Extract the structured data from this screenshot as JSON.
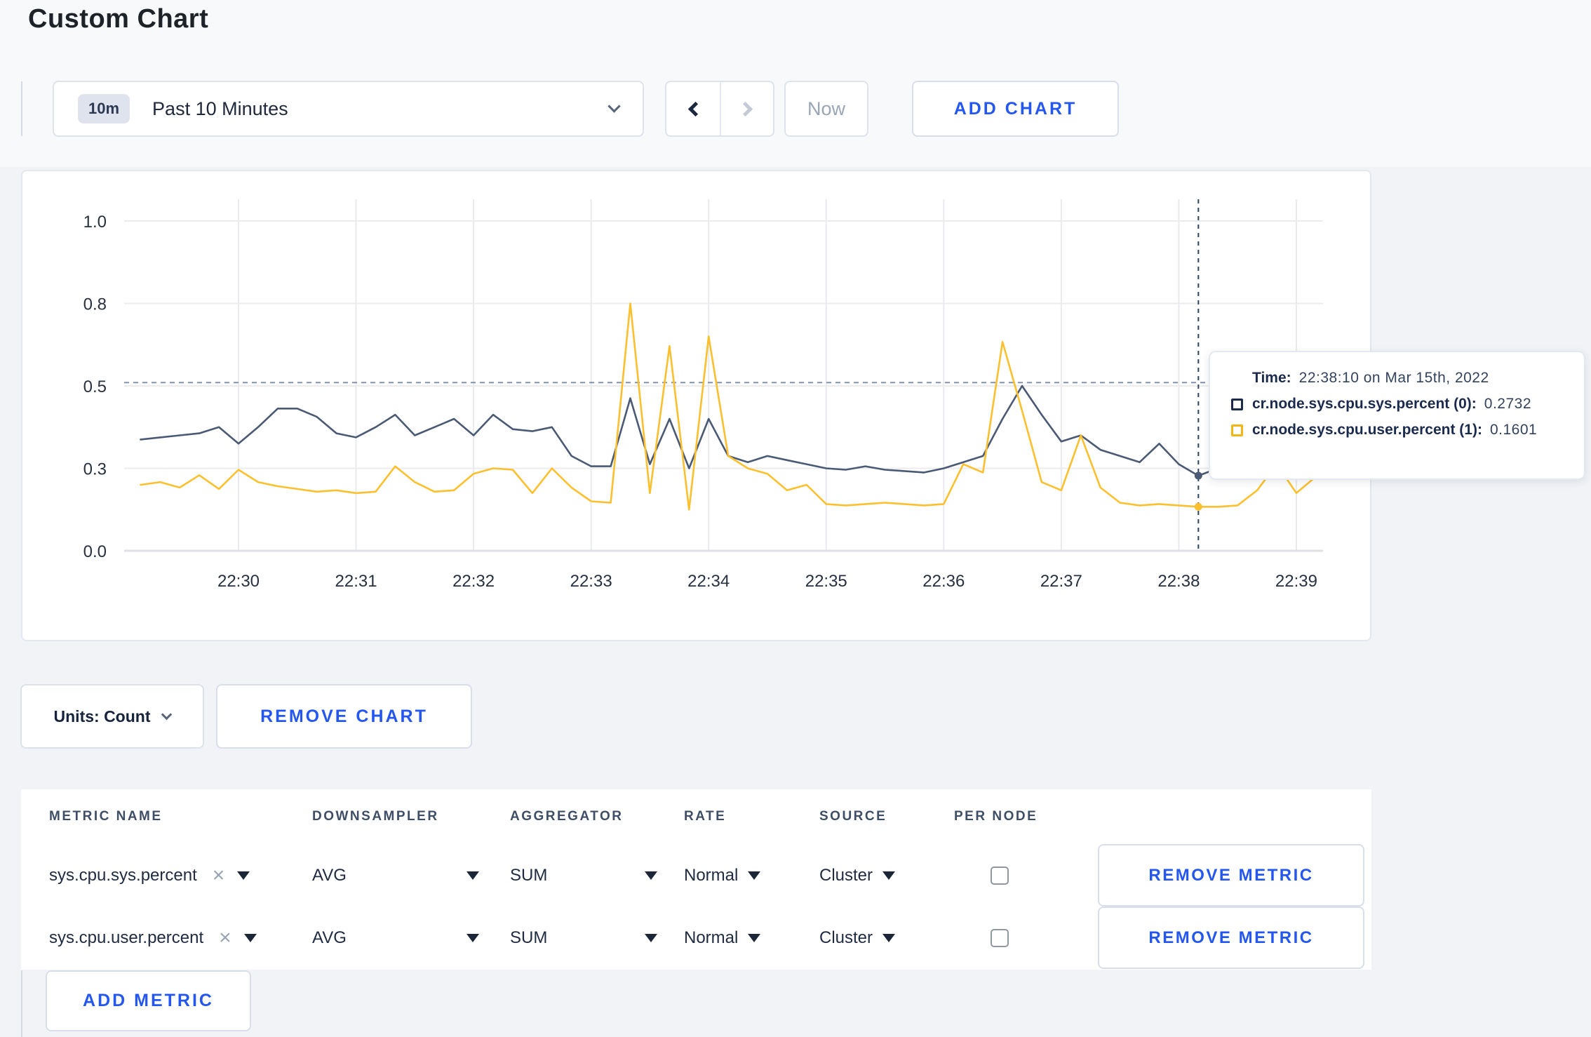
{
  "page": {
    "title": "Custom Chart"
  },
  "toolbar": {
    "time_badge": "10m",
    "time_label": "Past 10 Minutes",
    "now_label": "Now",
    "add_chart_label": "ADD CHART"
  },
  "chart_data": {
    "type": "line",
    "title": "",
    "xlabel": "",
    "ylabel": "",
    "grid": true,
    "legend_position": "tooltip",
    "x_tick_labels": [
      "22:30",
      "22:31",
      "22:32",
      "22:33",
      "22:34",
      "22:35",
      "22:36",
      "22:37",
      "22:38",
      "22:39"
    ],
    "y_ticks": [
      {
        "value": 0.0,
        "label": "0.0"
      },
      {
        "value": 0.3,
        "label": "0.3"
      },
      {
        "value": 0.5,
        "label": "0.5"
      },
      {
        "value": 0.8,
        "label": "0.8"
      },
      {
        "value": 1.0,
        "label": "1.0"
      }
    ],
    "ylim": [
      0,
      1.0
    ],
    "x_start": "22:29:10",
    "interval_seconds": 10,
    "series": [
      {
        "name": "cr.node.sys.cpu.sys.percent (0)",
        "color": "#4a5a75",
        "values": [
          0.37,
          0.375,
          0.38,
          0.385,
          0.4,
          0.36,
          0.4,
          0.445,
          0.445,
          0.425,
          0.385,
          0.375,
          0.4,
          0.43,
          0.38,
          0.4,
          0.42,
          0.38,
          0.43,
          0.395,
          0.39,
          0.4,
          0.33,
          0.305,
          0.305,
          0.47,
          0.31,
          0.42,
          0.3,
          0.42,
          0.33,
          0.315,
          0.33,
          0.32,
          0.31,
          0.3,
          0.295,
          0.305,
          0.295,
          0.29,
          0.285,
          0.3,
          0.315,
          0.33,
          0.42,
          0.5,
          0.43,
          0.365,
          0.38,
          0.345,
          0.33,
          0.315,
          0.36,
          0.31,
          0.2732,
          0.3,
          0.31,
          0.325,
          0.3,
          0.295,
          0.305
        ]
      },
      {
        "name": "cr.node.sys.cpu.user.percent (1)",
        "color": "#fcc02e",
        "values": [
          0.24,
          0.25,
          0.23,
          0.275,
          0.225,
          0.295,
          0.25,
          0.235,
          0.225,
          0.215,
          0.22,
          0.21,
          0.215,
          0.305,
          0.25,
          0.215,
          0.22,
          0.28,
          0.3,
          0.295,
          0.21,
          0.3,
          0.23,
          0.18,
          0.175,
          0.8,
          0.21,
          0.645,
          0.15,
          0.68,
          0.33,
          0.3,
          0.28,
          0.22,
          0.24,
          0.17,
          0.165,
          0.17,
          0.175,
          0.17,
          0.165,
          0.17,
          0.31,
          0.285,
          0.66,
          0.44,
          0.25,
          0.22,
          0.38,
          0.23,
          0.175,
          0.165,
          0.17,
          0.165,
          0.1601,
          0.16,
          0.165,
          0.22,
          0.31,
          0.21,
          0.27
        ]
      }
    ],
    "hover": {
      "time": "22:38:10",
      "values": [
        0.2732,
        0.1601
      ]
    },
    "guide_value": 0.512,
    "crosshair_color": "#2a4560",
    "guide_color": "#8093aa"
  },
  "tooltip": {
    "time_label": "Time:",
    "time_value": "22:38:10 on Mar 15th, 2022",
    "series": [
      {
        "label": "cr.node.sys.cpu.sys.percent (0):",
        "value": "0.2732",
        "color": "#1b2b4d"
      },
      {
        "label": "cr.node.sys.cpu.user.percent (1):",
        "value": "0.1601",
        "color": "#f1b514"
      }
    ]
  },
  "chart_controls": {
    "units_label": "Units: Count",
    "remove_chart_label": "REMOVE CHART"
  },
  "metrics_table": {
    "headers": [
      "METRIC NAME",
      "DOWNSAMPLER",
      "AGGREGATOR",
      "RATE",
      "SOURCE",
      "PER NODE"
    ],
    "rows": [
      {
        "name": "sys.cpu.sys.percent",
        "downsampler": "AVG",
        "aggregator": "SUM",
        "rate": "Normal",
        "source": "Cluster",
        "per_node": false
      },
      {
        "name": "sys.cpu.user.percent",
        "downsampler": "AVG",
        "aggregator": "SUM",
        "rate": "Normal",
        "source": "Cluster",
        "per_node": false
      }
    ],
    "remove_metric_label": "REMOVE METRIC",
    "add_metric_label": "ADD METRIC"
  },
  "icons": {
    "remove_x": "×"
  },
  "colors": {
    "accent_blue": "#2457f0",
    "navy_series": "#4a5a75",
    "yellow_series": "#fcc02e",
    "page_bg": "#f1f3f7"
  }
}
